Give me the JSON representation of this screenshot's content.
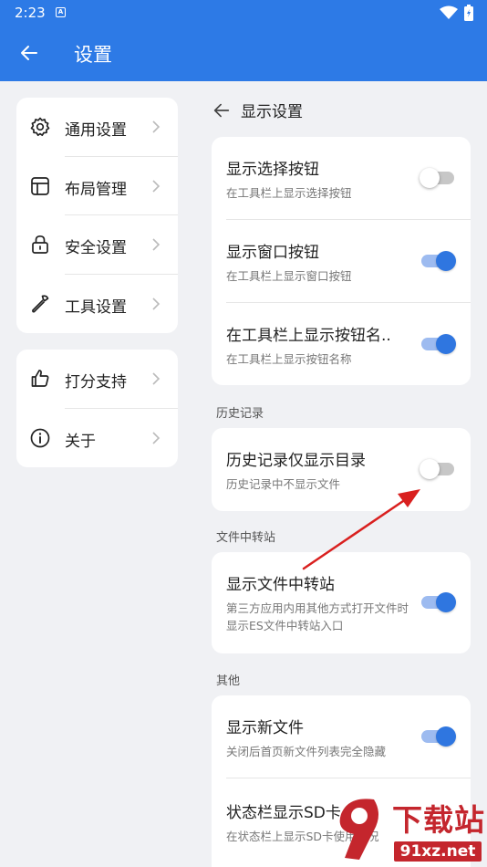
{
  "status_bar": {
    "time": "2:23",
    "notification_icon": "a-box-icon",
    "icons": [
      "wifi-icon",
      "battery-charging-icon"
    ]
  },
  "app_bar": {
    "title": "设置",
    "back_icon": "arrow-left-icon"
  },
  "sidebar": {
    "group1": [
      {
        "label": "通用设置",
        "icon": "gear-icon"
      },
      {
        "label": "布局管理",
        "icon": "layout-icon"
      },
      {
        "label": "安全设置",
        "icon": "lock-icon"
      },
      {
        "label": "工具设置",
        "icon": "wrench-icon"
      }
    ],
    "group2": [
      {
        "label": "打分支持",
        "icon": "thumbs-up-icon"
      },
      {
        "label": "关于",
        "icon": "info-icon"
      }
    ]
  },
  "main": {
    "header": "显示设置",
    "display_card": [
      {
        "title": "显示选择按钮",
        "subtitle": "在工具栏上显示选择按钮",
        "enabled": false
      },
      {
        "title": "显示窗口按钮",
        "subtitle": "在工具栏上显示窗口按钮",
        "enabled": true
      },
      {
        "title": "在工具栏上显示按钮名..",
        "subtitle": "在工具栏上显示按钮名称",
        "enabled": true
      }
    ],
    "history": {
      "label": "历史记录",
      "items": [
        {
          "title": "历史记录仅显示目录",
          "subtitle": "历史记录中不显示文件",
          "enabled": false
        }
      ]
    },
    "transfer": {
      "label": "文件中转站",
      "items": [
        {
          "title": "显示文件中转站",
          "subtitle": "第三方应用内用其他方式打开文件时显示ES文件中转站入口",
          "enabled": true
        }
      ]
    },
    "other": {
      "label": "其他",
      "items": [
        {
          "title": "显示新文件",
          "subtitle": "关闭后首页新文件列表完全隐藏",
          "enabled": true
        },
        {
          "title": "状态栏显示SD卡",
          "subtitle": "在状态栏上显示SD卡使用情况",
          "enabled": null
        }
      ]
    }
  },
  "watermark": {
    "brand": "下载站",
    "url": "91xz.net"
  },
  "colors": {
    "primary": "#2d7ae6",
    "toggle_on": "#2f76e0",
    "annotation_arrow": "#d9201f",
    "watermark": "#c4262d"
  }
}
